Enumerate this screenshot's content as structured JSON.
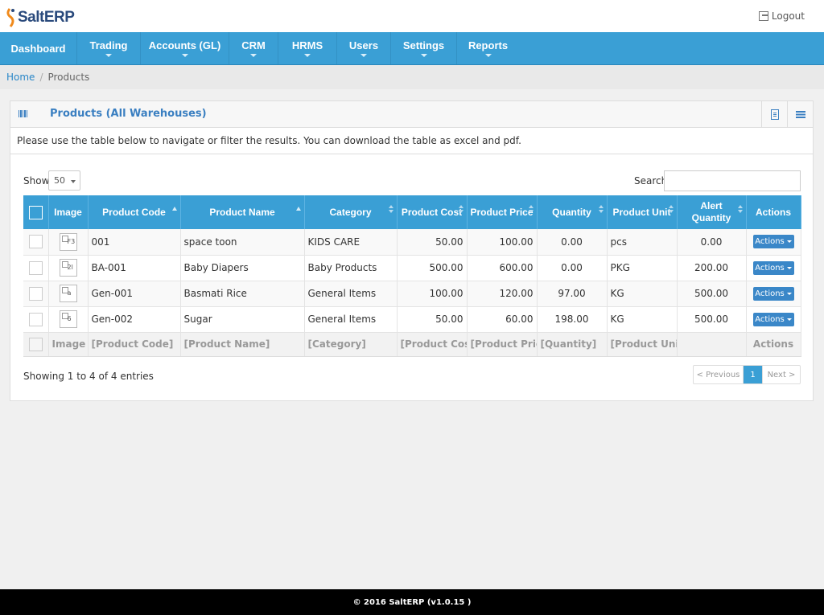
{
  "app": {
    "logo_text": "SaltERP",
    "logout": "Logout"
  },
  "nav": [
    {
      "label": "Dashboard",
      "has_caret": false
    },
    {
      "label": "Trading",
      "has_caret": true
    },
    {
      "label": "Accounts (GL)",
      "has_caret": true
    },
    {
      "label": "CRM",
      "has_caret": true
    },
    {
      "label": "HRMS",
      "has_caret": true
    },
    {
      "label": "Users",
      "has_caret": true
    },
    {
      "label": "Settings",
      "has_caret": true
    },
    {
      "label": "Reports",
      "has_caret": true
    }
  ],
  "breadcrumb": {
    "home": "Home",
    "separator": "/",
    "current": "Products"
  },
  "panel": {
    "title": "Products (All Warehouses)",
    "intro": "Please use the table below to navigate or filter the results. You can download the table as excel and pdf."
  },
  "controls": {
    "show_label": "Show",
    "show_value": "50",
    "search_label": "Search",
    "search_value": ""
  },
  "table": {
    "headers": [
      "Image",
      "Product Code",
      "Product Name",
      "Category",
      "Product Cost",
      "Product Price",
      "Quantity",
      "Product Unit",
      "Alert Quantity",
      "Actions"
    ],
    "rows": [
      {
        "image": "F3",
        "code": "001",
        "name": "space toon",
        "category": "KIDS CARE",
        "cost": "50.00",
        "price": "100.00",
        "quantity": "0.00",
        "unit": "pcs",
        "alert": "0.00",
        "action": "Actions"
      },
      {
        "image": "2l",
        "code": "BA-001",
        "name": "Baby Diapers",
        "category": "Baby Products",
        "cost": "500.00",
        "price": "600.00",
        "quantity": "0.00",
        "unit": "PKG",
        "alert": "200.00",
        "action": "Actions"
      },
      {
        "image": "a",
        "code": "Gen-001",
        "name": "Basmati Rice",
        "category": "General Items",
        "cost": "100.00",
        "price": "120.00",
        "quantity": "97.00",
        "unit": "KG",
        "alert": "500.00",
        "action": "Actions"
      },
      {
        "image": "6",
        "code": "Gen-002",
        "name": "Sugar",
        "category": "General Items",
        "cost": "50.00",
        "price": "60.00",
        "quantity": "198.00",
        "unit": "KG",
        "alert": "500.00",
        "action": "Actions"
      }
    ],
    "footer": [
      "Image",
      "[Product Code]",
      "[Product Name]",
      "[Category]",
      "[Product Cost]",
      "[Product Price",
      "[Quantity]",
      "[Product Unit]",
      "",
      "Actions"
    ]
  },
  "info": "Showing 1 to 4 of 4 entries",
  "pager": {
    "prev": "< Previous",
    "page": "1",
    "next": "Next >"
  },
  "footer": "© 2016 SaltERP (v1.0.15 )",
  "colors": {
    "nav": "#3a9fd5",
    "accent": "#3a7fc1",
    "button": "#3a87c8",
    "footer": "#000000"
  }
}
